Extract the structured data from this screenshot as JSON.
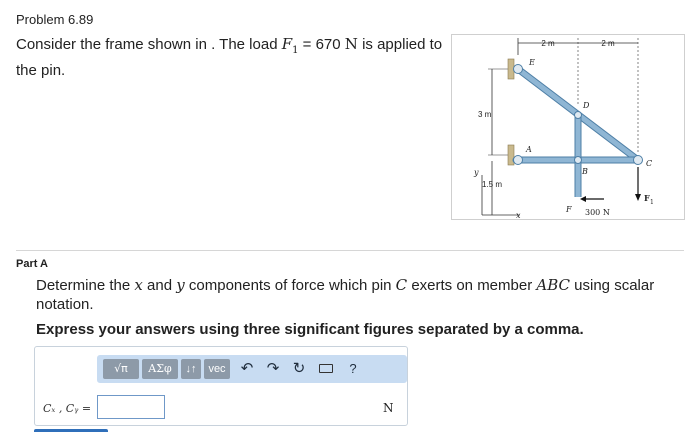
{
  "problem": {
    "title": "Problem 6.89",
    "text_before": "Consider the frame shown in . The load ",
    "load_symbol": "F",
    "load_subscript": "1",
    "load_equals": " = 670 ",
    "load_unit": "N",
    "text_after": " is applied to the pin."
  },
  "figure": {
    "labels": {
      "dim_top_left": "2 m",
      "dim_top_right": "2 m",
      "dim_left": "3 m",
      "dim_bottom_left": "1.5 m",
      "axis_y": "y",
      "axis_x": "x",
      "pin_e": "E",
      "pin_d": "D",
      "pin_a": "A",
      "pin_b": "B",
      "pin_c": "C",
      "point_f": "F",
      "force_300": "300 N",
      "force_f1": "F",
      "force_f1_sub": "1"
    },
    "colors": {
      "member": "#8fb6d4",
      "member_edge": "#4e7fa6",
      "dim_line": "#333333",
      "support": "#c9b98d"
    }
  },
  "part": {
    "label": "Part A",
    "question_parts": [
      "Determine the ",
      "x",
      " and ",
      "y",
      " components of force which pin ",
      "C",
      " exerts on member ",
      "ABC",
      " using scalar notation."
    ],
    "instruction": "Express your answers using three significant figures separated by a comma."
  },
  "answer": {
    "toolbar": {
      "templates_icon": "fraction-sqrt-icon",
      "templates_label": "√π",
      "greek_label": "ΑΣφ",
      "arrows_label": "↓↑",
      "vec_label": "vec",
      "undo_icon": "undo-icon",
      "redo_icon": "redo-icon",
      "reset_icon": "reset-icon",
      "keyboard_icon": "keyboard-icon",
      "help_label": "?"
    },
    "label": "Cₓ , Cᵧ =",
    "value": "",
    "unit": "N"
  }
}
